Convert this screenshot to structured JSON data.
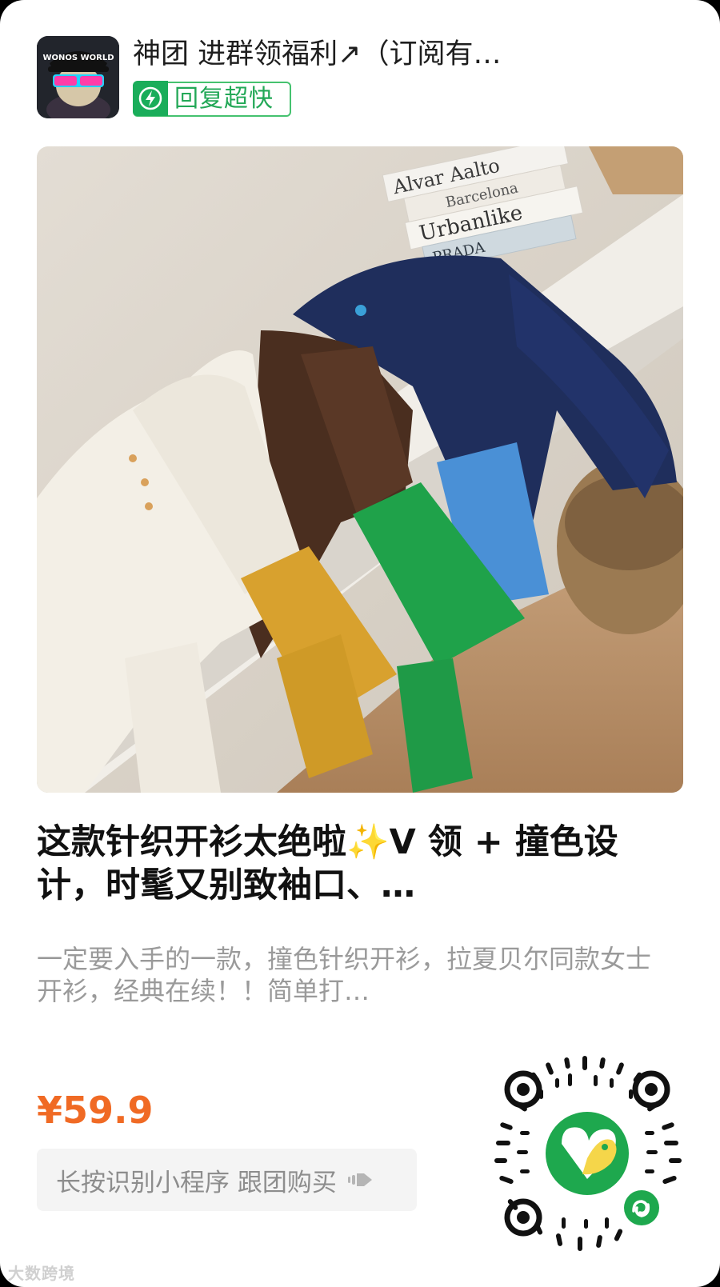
{
  "shop": {
    "name": "神团 进群领福利↗（订阅有…",
    "avatar_icon": "wonos-world-avatar",
    "avatar_text": "WONOS WORLD",
    "reply_badge": "回复超快"
  },
  "product": {
    "photo_book_spines": [
      "Alvar Aalto",
      "Barcelona",
      "Urbanlike",
      "PRADA"
    ],
    "title": "这款针织开衫太绝啦✨V 领 + 撞色设计，时髦又别致袖口、…",
    "description": "一定要入手的一款，撞色针织开衫，拉夏贝尔同款女士开衫，经典在续！！简单打…",
    "price": "¥59.9"
  },
  "cta": {
    "label": "长按识别小程序 跟团购买",
    "icon": "hand-pointer-icon"
  },
  "qr": {
    "icon": "mini-program-qr-code"
  },
  "watermark": "大数跨境",
  "colors": {
    "price": "#f06a24",
    "badge_green": "#23a857"
  }
}
